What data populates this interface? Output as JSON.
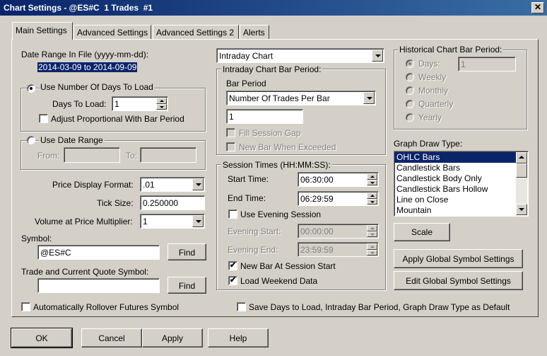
{
  "window": {
    "title": "Chart Settings - @ES#C  1 Trades  #1",
    "close_glyph": "✕"
  },
  "tabs": [
    {
      "label": "Main Settings"
    },
    {
      "label": "Advanced Settings"
    },
    {
      "label": "Advanced Settings 2"
    },
    {
      "label": "Alerts"
    }
  ],
  "left": {
    "date_range_label": "Date Range In File (yyyy-mm-dd):",
    "date_range_value": "2014-03-09 to 2014-09-09",
    "use_days_label": "Use Number Of Days To Load",
    "days_to_load_label": "Days To Load:",
    "days_to_load_value": "1",
    "adjust_label": "Adjust Proportional With Bar Period",
    "use_date_range_label": "Use Date Range",
    "from_label": "From:",
    "to_label": "To:",
    "price_display_label": "Price Display Format:",
    "price_display_value": ".01",
    "tick_size_label": "Tick Size:",
    "tick_size_value": "0.250000",
    "vap_label": "Volume at Price Multiplier:",
    "vap_value": "1",
    "symbol_label": "Symbol:",
    "symbol_value": "@ES#C",
    "find_label": "Find",
    "trade_symbol_label": "Trade and Current Quote Symbol:",
    "trade_symbol_value": "",
    "find2_label": "Find",
    "rollover_label": "Automatically Rollover Futures Symbol"
  },
  "middle": {
    "chart_type_value": "Intraday Chart",
    "intraday_period_title": "Intraday Chart Bar Period:",
    "bar_period_label": "Bar Period",
    "bar_period_value": "Number Of Trades Per Bar",
    "bar_period_number": "1",
    "fill_gap_label": "Fill Session Gap",
    "new_bar_exceeded_label": "New Bar When Exceeded",
    "session_title": "Session Times (HH:MM:SS):",
    "start_time_label": "Start Time:",
    "start_time_value": "06:30:00",
    "end_time_label": "End Time:",
    "end_time_value": "06:29:59",
    "use_evening_label": "Use Evening Session",
    "evening_start_label": "Evening Start:",
    "evening_start_value": "00:00:00",
    "evening_end_label": "Evening End:",
    "evening_end_value": "23:59:59",
    "new_bar_session_label": "New Bar At Session Start",
    "load_weekend_label": "Load Weekend Data",
    "save_default_label": "Save Days to Load, Intraday Bar Period, Graph Draw Type as Default"
  },
  "right": {
    "historical_title": "Historical Chart Bar Period:",
    "days_label": "Days:",
    "days_value": "1",
    "weekly_label": "Weekly",
    "monthly_label": "Monthly",
    "quarterly_label": "Quarterly",
    "yearly_label": "Yearly",
    "graph_draw_label": "Graph Draw Type:",
    "graph_draw_items": [
      "OHLC Bars",
      "Candlestick Bars",
      "Candlestick Body Only",
      "Candlestick Bars Hollow",
      "Line on Close",
      "Mountain"
    ],
    "scale_label": "Scale",
    "apply_global_label": "Apply Global Symbol Settings",
    "edit_global_label": "Edit Global Symbol Settings"
  },
  "footer": {
    "ok": "OK",
    "cancel": "Cancel",
    "apply": "Apply",
    "help": "Help"
  },
  "check_glyph": "✔"
}
